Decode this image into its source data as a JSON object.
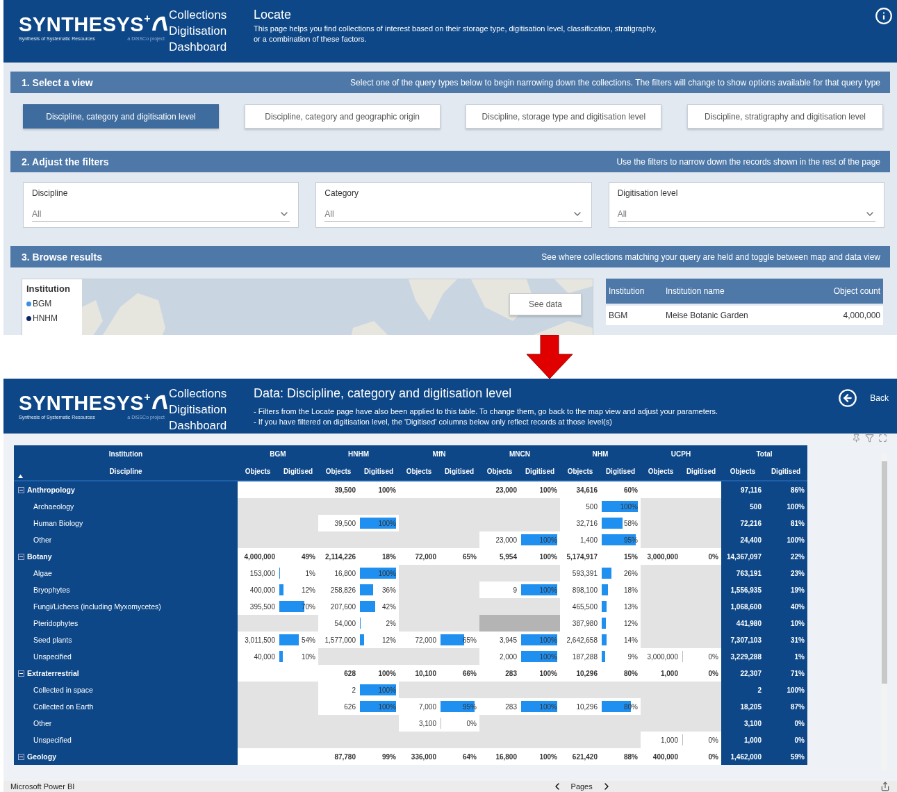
{
  "top_screen": {
    "logo": {
      "wordmark": "SYNTHESYS",
      "plus": "+",
      "tagline": "Synthesis of Systematic Resources",
      "project": "a DiSSCo project"
    },
    "app_title": [
      "Collections",
      "Digitisation",
      "Dashboard"
    ],
    "page_title": "Locate",
    "description": "This page helps you find collections of interest based on their storage type, digitisation level, classification, stratigraphy, or a combination of these factors.",
    "select_view": {
      "title": "1. Select a view",
      "hint": "Select one of the query types below to begin narrowing down the collections. The filters will change to show options available for that query type",
      "views": [
        {
          "label": "Discipline, category and digitisation level",
          "selected": true
        },
        {
          "label": "Discipline, category and geographic origin",
          "selected": false
        },
        {
          "label": "Discipline, storage type and digitisation level",
          "selected": false
        },
        {
          "label": "Discipline, stratigraphy and digitisation level",
          "selected": false
        }
      ]
    },
    "filters": {
      "title": "2. Adjust the filters",
      "hint": "Use the filters to narrow down the records shown in the rest of the page",
      "dropdowns": [
        {
          "label": "Discipline",
          "value": "All"
        },
        {
          "label": "Category",
          "value": "All"
        },
        {
          "label": "Digitisation level",
          "value": "All"
        }
      ]
    },
    "browse": {
      "title": "3. Browse results",
      "hint": "See where collections matching your query are held and toggle between map and data view",
      "legend": {
        "title": "Institution",
        "items": [
          {
            "label": "BGM",
            "color": "#3b8ee0"
          },
          {
            "label": "HNHM",
            "color": "#0b2566"
          }
        ]
      },
      "see_data": "See data",
      "results_table": {
        "columns": [
          "Institution",
          "Institution name",
          "Object count"
        ],
        "rows": [
          [
            "BGM",
            "Meise Botanic Garden",
            "4,000,000"
          ]
        ]
      }
    }
  },
  "data_screen": {
    "logo": {
      "wordmark": "SYNTHESYS",
      "plus": "+",
      "tagline": "Synthesis of Systematic Resources",
      "project": "a DiSSCo project"
    },
    "app_title": [
      "Collections",
      "Digitisation",
      "Dashboard"
    ],
    "page_title": "Data: Discipline, category and digitisation level",
    "notes": [
      "- Filters from the Locate page have also been applied to this table. To change them, go back to the map view and adjust your parameters.",
      "- If you have filtered on digitisation level, the 'Digitised' columns below only reflect records at those level(s)"
    ],
    "back_label": "Back",
    "table": {
      "institution_label": "Institution",
      "discipline_label": "Discipline",
      "institutions": [
        {
          "name": "BGM",
          "subcolumns": [
            "Objects",
            "Digitised"
          ],
          "kind": "site"
        },
        {
          "name": "HNHM",
          "subcolumns": [
            "Objects",
            "Digitised"
          ],
          "kind": "site"
        },
        {
          "name": "MfN",
          "subcolumns": [
            "Objects",
            "Digitised"
          ],
          "kind": "site"
        },
        {
          "name": "MNCN",
          "subcolumns": [
            "Objects",
            "Digitised"
          ],
          "kind": "site"
        },
        {
          "name": "NHM",
          "subcolumns": [
            "Objects",
            "Digitised"
          ],
          "kind": "site"
        },
        {
          "name": "UCPH",
          "subcolumns": [
            "Objects",
            "Digitised"
          ],
          "kind": "site"
        },
        {
          "name": "Total",
          "subcolumns": [
            "Objects",
            "Digitised"
          ],
          "kind": "total"
        }
      ],
      "rows": [
        {
          "name": "Anthropology",
          "kind": "group",
          "cells": [
            null,
            {
              "kind": "data",
              "objects": "39,500",
              "digitised": "100%"
            },
            null,
            {
              "kind": "data",
              "objects": "23,000",
              "digitised": "100%"
            },
            {
              "kind": "data",
              "objects": "34,616",
              "digitised": "60%"
            },
            null,
            {
              "kind": "data",
              "objects": "97,116",
              "digitised": "86%"
            }
          ]
        },
        {
          "name": "Archaeology",
          "kind": "sub",
          "cells": [
            null,
            null,
            null,
            null,
            {
              "kind": "data",
              "objects": "500",
              "digitised": "100%",
              "level": 1
            },
            null,
            {
              "kind": "data",
              "objects": "500",
              "digitised": "100%"
            }
          ]
        },
        {
          "name": "Human Biology",
          "kind": "sub",
          "cells": [
            null,
            {
              "kind": "data",
              "objects": "39,500",
              "digitised": "100%",
              "level": 1
            },
            null,
            null,
            {
              "kind": "data",
              "objects": "32,716",
              "digitised": "58%",
              "level": 0.58
            },
            null,
            {
              "kind": "data",
              "objects": "72,216",
              "digitised": "81%"
            }
          ]
        },
        {
          "name": "Other",
          "kind": "sub",
          "cells": [
            null,
            null,
            null,
            {
              "kind": "data",
              "objects": "23,000",
              "digitised": "100%",
              "level": 1
            },
            {
              "kind": "data",
              "objects": "1,400",
              "digitised": "95%",
              "level": 0.95
            },
            null,
            {
              "kind": "data",
              "objects": "24,400",
              "digitised": "100%"
            }
          ]
        },
        {
          "name": "Botany",
          "kind": "group",
          "cells": [
            {
              "kind": "data",
              "objects": "4,000,000",
              "digitised": "49%"
            },
            {
              "kind": "data",
              "objects": "2,114,226",
              "digitised": "18%"
            },
            {
              "kind": "data",
              "objects": "72,000",
              "digitised": "65%"
            },
            {
              "kind": "data",
              "objects": "5,954",
              "digitised": "100%"
            },
            {
              "kind": "data",
              "objects": "5,174,917",
              "digitised": "15%"
            },
            {
              "kind": "data",
              "objects": "3,000,000",
              "digitised": "0%"
            },
            {
              "kind": "data",
              "objects": "14,367,097",
              "digitised": "22%"
            }
          ]
        },
        {
          "name": "Algae",
          "kind": "sub",
          "cells": [
            {
              "kind": "data",
              "objects": "153,000",
              "digitised": "1%",
              "level": 0.01
            },
            {
              "kind": "data",
              "objects": "16,800",
              "digitised": "100%",
              "level": 1
            },
            null,
            null,
            {
              "kind": "data",
              "objects": "593,391",
              "digitised": "26%",
              "level": 0.26
            },
            null,
            {
              "kind": "data",
              "objects": "763,191",
              "digitised": "23%"
            }
          ]
        },
        {
          "name": "Bryophytes",
          "kind": "sub",
          "cells": [
            {
              "kind": "data",
              "objects": "400,000",
              "digitised": "12%",
              "level": 0.12
            },
            {
              "kind": "data",
              "objects": "258,826",
              "digitised": "36%",
              "level": 0.36
            },
            null,
            {
              "kind": "data",
              "objects": "9",
              "digitised": "100%",
              "level": 1
            },
            {
              "kind": "data",
              "objects": "898,100",
              "digitised": "18%",
              "level": 0.18
            },
            null,
            {
              "kind": "data",
              "objects": "1,556,935",
              "digitised": "19%"
            }
          ]
        },
        {
          "name": "Fungi/Lichens (including Myxomycetes)",
          "kind": "sub",
          "cells": [
            {
              "kind": "data",
              "objects": "395,500",
              "digitised": "70%",
              "level": 0.7
            },
            {
              "kind": "data",
              "objects": "207,600",
              "digitised": "42%",
              "level": 0.42
            },
            null,
            null,
            {
              "kind": "data",
              "objects": "465,500",
              "digitised": "13%",
              "level": 0.13
            },
            null,
            {
              "kind": "data",
              "objects": "1,068,600",
              "digitised": "40%"
            }
          ]
        },
        {
          "name": "Pteridophytes",
          "kind": "sub",
          "cells": [
            null,
            {
              "kind": "data",
              "objects": "54,000",
              "digitised": "2%",
              "level": 0.02
            },
            null,
            {
              "kind": "shaded"
            },
            {
              "kind": "data",
              "objects": "387,980",
              "digitised": "12%",
              "level": 0.12
            },
            null,
            {
              "kind": "data",
              "objects": "441,980",
              "digitised": "10%"
            }
          ]
        },
        {
          "name": "Seed plants",
          "kind": "sub",
          "cells": [
            {
              "kind": "data",
              "objects": "3,011,500",
              "digitised": "54%",
              "level": 0.54
            },
            {
              "kind": "data",
              "objects": "1,577,000",
              "digitised": "12%",
              "level": 0.12
            },
            {
              "kind": "data",
              "objects": "72,000",
              "digitised": "65%",
              "level": 0.65
            },
            {
              "kind": "data",
              "objects": "3,945",
              "digitised": "100%",
              "level": 1
            },
            {
              "kind": "data",
              "objects": "2,642,658",
              "digitised": "14%",
              "level": 0.14
            },
            null,
            {
              "kind": "data",
              "objects": "7,307,103",
              "digitised": "31%"
            }
          ]
        },
        {
          "name": "Unspecified",
          "kind": "sub",
          "cells": [
            {
              "kind": "data",
              "objects": "40,000",
              "digitised": "10%",
              "level": 0.1
            },
            null,
            null,
            {
              "kind": "data",
              "objects": "2,000",
              "digitised": "100%",
              "level": 1
            },
            {
              "kind": "data",
              "objects": "187,288",
              "digitised": "9%",
              "level": 0.09
            },
            {
              "kind": "data",
              "objects": "3,000,000",
              "digitised": "0%",
              "level": 0
            },
            {
              "kind": "data",
              "objects": "3,229,288",
              "digitised": "1%"
            }
          ]
        },
        {
          "name": "Extraterrestrial",
          "kind": "group",
          "cells": [
            null,
            {
              "kind": "data",
              "objects": "628",
              "digitised": "100%"
            },
            {
              "kind": "data",
              "objects": "10,100",
              "digitised": "66%"
            },
            {
              "kind": "data",
              "objects": "283",
              "digitised": "100%"
            },
            {
              "kind": "data",
              "objects": "10,296",
              "digitised": "80%"
            },
            {
              "kind": "data",
              "objects": "1,000",
              "digitised": "0%"
            },
            {
              "kind": "data",
              "objects": "22,307",
              "digitised": "71%"
            }
          ]
        },
        {
          "name": "Collected in space",
          "kind": "sub",
          "cells": [
            null,
            {
              "kind": "data",
              "objects": "2",
              "digitised": "100%",
              "level": 1
            },
            null,
            null,
            null,
            null,
            {
              "kind": "data",
              "objects": "2",
              "digitised": "100%"
            }
          ]
        },
        {
          "name": "Collected on Earth",
          "kind": "sub",
          "cells": [
            null,
            {
              "kind": "data",
              "objects": "626",
              "digitised": "100%",
              "level": 1
            },
            {
              "kind": "data",
              "objects": "7,000",
              "digitised": "95%",
              "level": 0.95
            },
            {
              "kind": "data",
              "objects": "283",
              "digitised": "100%",
              "level": 1
            },
            {
              "kind": "data",
              "objects": "10,296",
              "digitised": "80%",
              "level": 0.8
            },
            null,
            {
              "kind": "data",
              "objects": "18,205",
              "digitised": "87%"
            }
          ]
        },
        {
          "name": "Other",
          "kind": "sub",
          "cells": [
            null,
            null,
            {
              "kind": "data",
              "objects": "3,100",
              "digitised": "0%",
              "level": 0
            },
            null,
            null,
            null,
            {
              "kind": "data",
              "objects": "3,100",
              "digitised": "0%"
            }
          ]
        },
        {
          "name": "Unspecified",
          "kind": "sub",
          "cells": [
            null,
            null,
            null,
            null,
            null,
            {
              "kind": "data",
              "objects": "1,000",
              "digitised": "0%",
              "level": 0
            },
            {
              "kind": "data",
              "objects": "1,000",
              "digitised": "0%"
            }
          ]
        },
        {
          "name": "Geology",
          "kind": "group",
          "cells": [
            null,
            {
              "kind": "data",
              "objects": "87,780",
              "digitised": "99%"
            },
            {
              "kind": "data",
              "objects": "336,000",
              "digitised": "64%"
            },
            {
              "kind": "data",
              "objects": "16,800",
              "digitised": "100%"
            },
            {
              "kind": "data",
              "objects": "621,420",
              "digitised": "88%"
            },
            {
              "kind": "data",
              "objects": "400,000",
              "digitised": "0%"
            },
            {
              "kind": "data",
              "objects": "1,462,000",
              "digitised": "59%"
            }
          ]
        }
      ]
    },
    "footer": {
      "brand": "Microsoft Power BI",
      "pages_label": "Pages"
    }
  }
}
